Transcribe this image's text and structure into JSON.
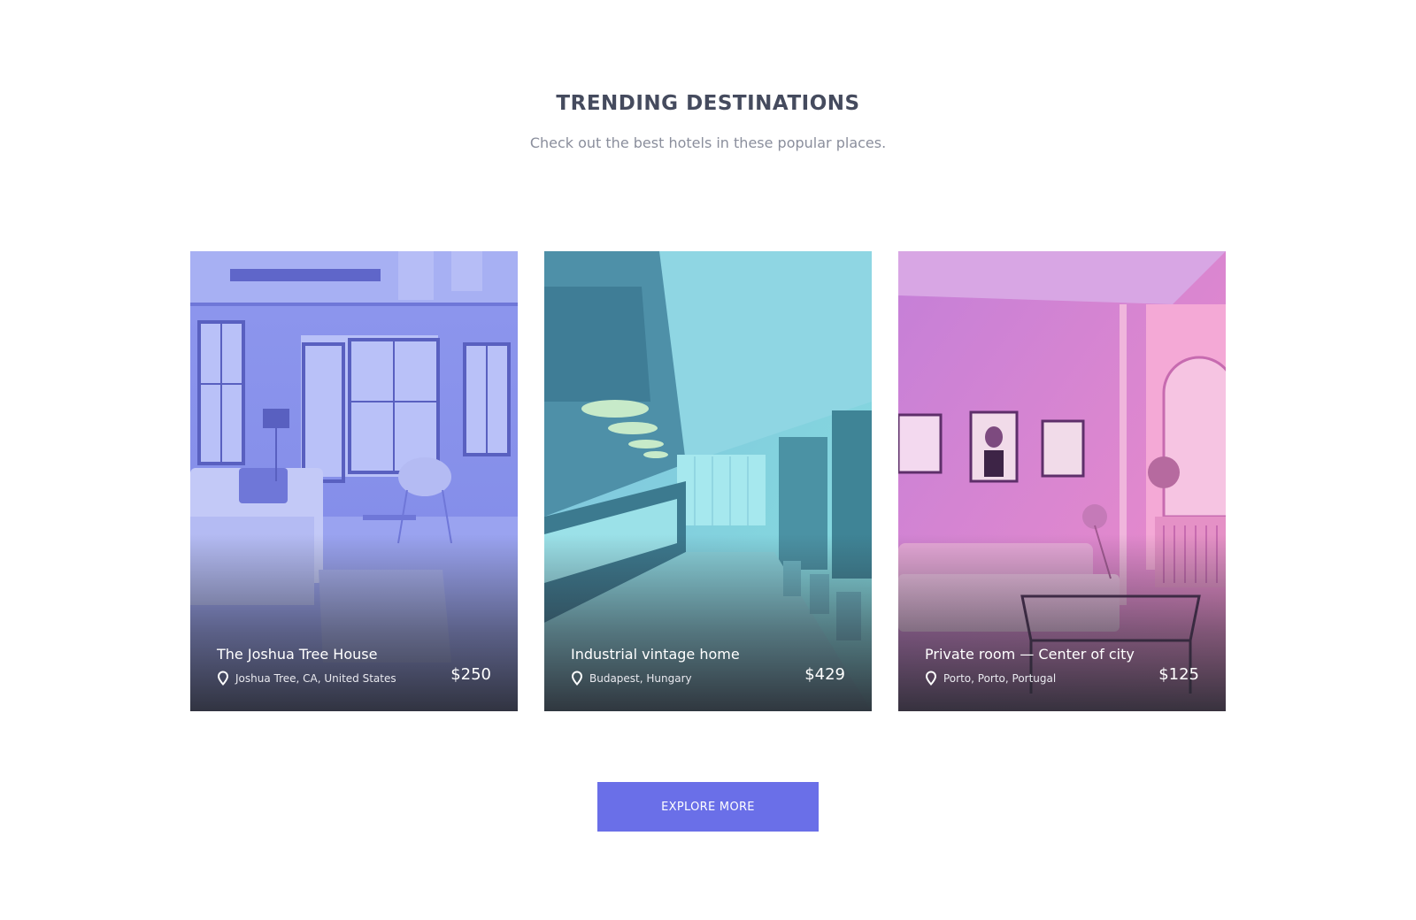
{
  "section": {
    "title": "TRENDING DESTINATIONS",
    "subtitle": "Check out the best hotels in these popular places."
  },
  "cards": [
    {
      "name": "The Joshua Tree House",
      "location": "Joshua Tree, CA, United States",
      "price": "$250",
      "tint": "#8c97ec"
    },
    {
      "name": "Industrial vintage home",
      "location": "Budapest, Hungary",
      "price": "$429",
      "tint": "#6fc4dc"
    },
    {
      "name": "Private room — Center of city",
      "location": "Porto, Porto, Portugal",
      "price": "$125",
      "tint": "#e08ad0"
    }
  ],
  "explore_button": {
    "label": "EXPLORE MORE",
    "color": "#6a6fe8"
  },
  "icons": {
    "location": "map-pin-icon"
  }
}
